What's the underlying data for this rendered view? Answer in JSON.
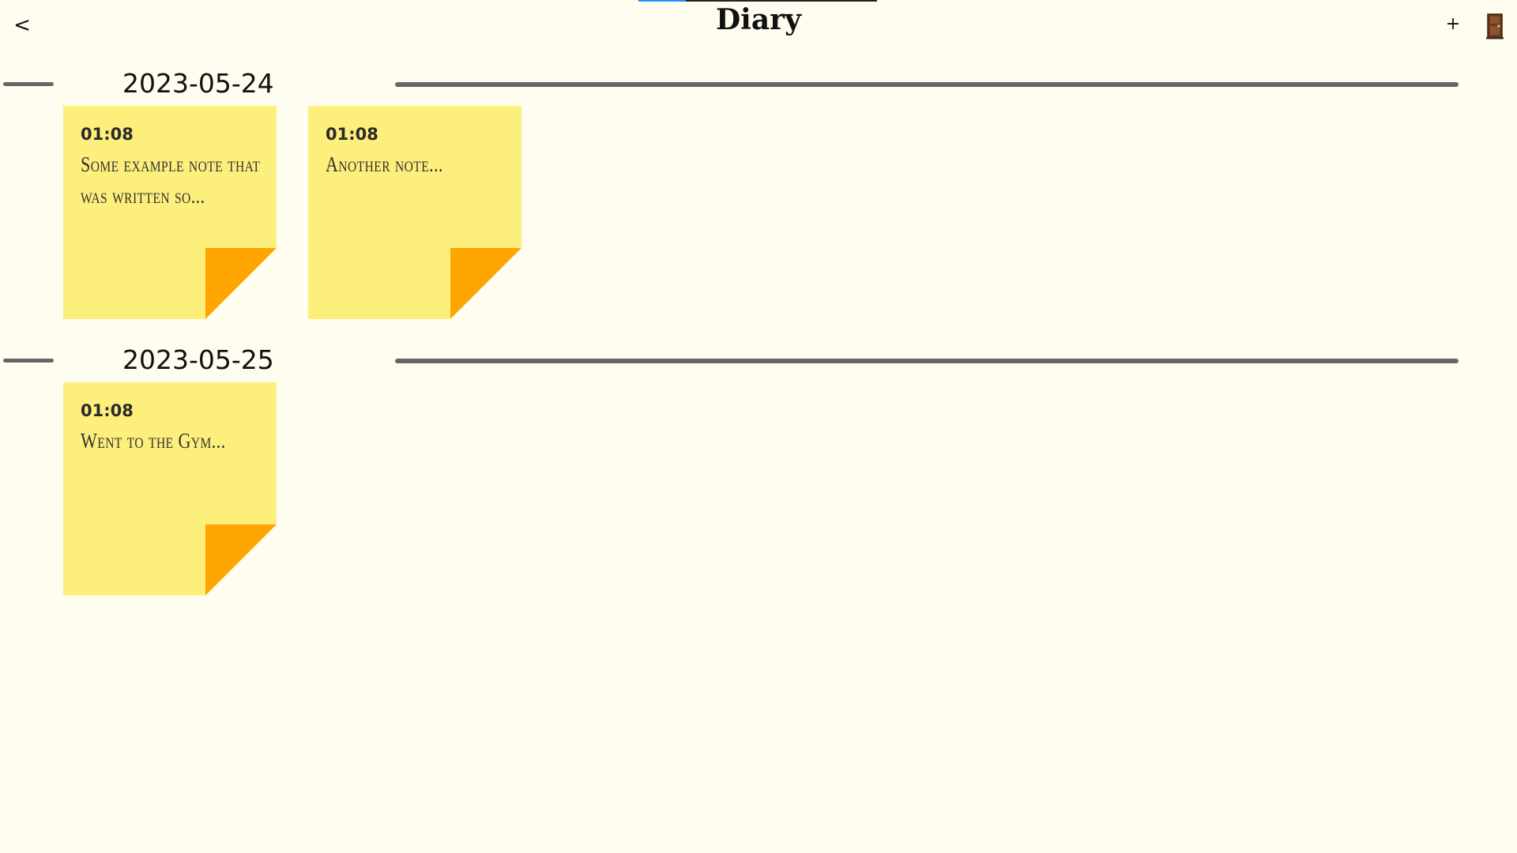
{
  "app": {
    "title": "Diary"
  },
  "loading": {
    "progress": 0.2
  },
  "header": {
    "back_label": "<",
    "add_label": "+",
    "logout_icon": "door-icon"
  },
  "days": [
    {
      "date": "2023-05-24",
      "notes": [
        {
          "time": "01:08",
          "text": "Some example note that was written so..."
        },
        {
          "time": "01:08",
          "text": "Another note..."
        }
      ]
    },
    {
      "date": "2023-05-25",
      "notes": [
        {
          "time": "01:08",
          "text": "Went to the Gym..."
        }
      ]
    }
  ],
  "colors": {
    "background": "#fffdf0",
    "note": "#fdef7c",
    "note_fold": "#ffa500",
    "rule": "#666666",
    "progress": "#1e90ff"
  }
}
